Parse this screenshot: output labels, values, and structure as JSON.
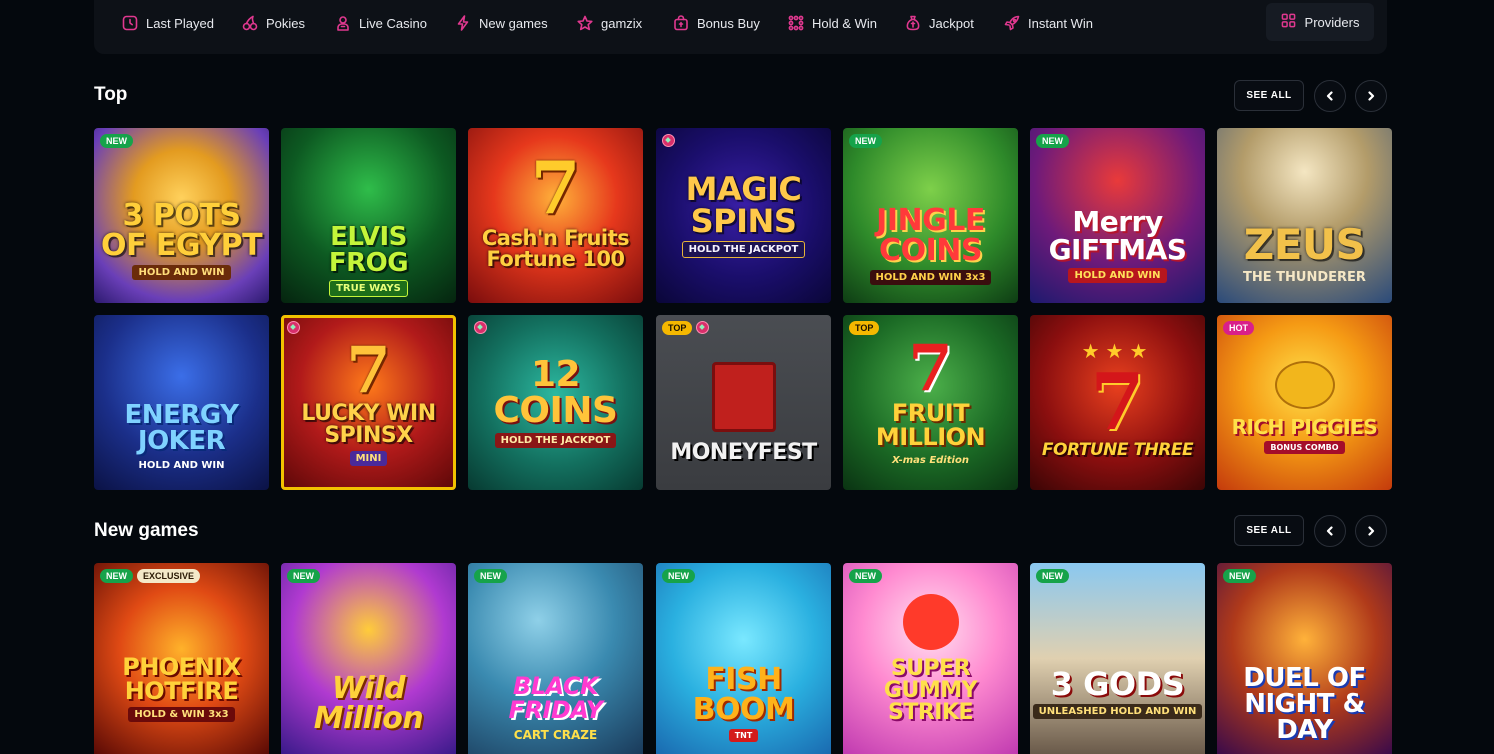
{
  "nav": {
    "items": [
      {
        "label": "Last Played",
        "icon": "clock-icon"
      },
      {
        "label": "Pokies",
        "icon": "cherries-icon"
      },
      {
        "label": "Live Casino",
        "icon": "dealer-icon"
      },
      {
        "label": "New games",
        "icon": "lightning-icon"
      },
      {
        "label": "gamzix",
        "icon": "star-icon"
      },
      {
        "label": "Bonus Buy",
        "icon": "bonus-bag-icon"
      },
      {
        "label": "Hold & Win",
        "icon": "grid-dots-icon"
      },
      {
        "label": "Jackpot",
        "icon": "money-bag-icon"
      },
      {
        "label": "Instant Win",
        "icon": "rocket-icon"
      }
    ],
    "providers_label": "Providers",
    "accent": "#e0388f"
  },
  "sections": [
    {
      "title": "Top",
      "see_all": "SEE ALL",
      "games": [
        {
          "name": "3 POTS OF EGYPT",
          "sub": "HOLD AND WIN",
          "badges": [
            "NEW"
          ],
          "gem": false
        },
        {
          "name": "ELVIS FROG",
          "sub": "TRUE WAYS",
          "badges": [],
          "gem": false
        },
        {
          "name": "Cash'n Fruits Fortune 100",
          "sub": "",
          "badges": [],
          "gem": false
        },
        {
          "name": "MAGIC SPINS",
          "sub": "HOLD THE JACKPOT",
          "badges": [],
          "gem": true
        },
        {
          "name": "JINGLE COINS",
          "sub": "HOLD AND WIN 3x3",
          "badges": [
            "NEW"
          ],
          "gem": false
        },
        {
          "name": "Merry GIFTMAS",
          "sub": "HOLD AND WIN",
          "badges": [
            "NEW"
          ],
          "gem": false
        },
        {
          "name": "ZEUS",
          "sub": "THE THUNDERER",
          "badges": [],
          "gem": false
        },
        {
          "name": "ENERGY JOKER",
          "sub": "HOLD AND WIN",
          "badges": [],
          "gem": false
        },
        {
          "name": "LUCKY WIN SPINSX",
          "sub": "MINI",
          "badges": [],
          "gem": true
        },
        {
          "name": "12 COINS",
          "sub": "HOLD THE JACKPOT",
          "badges": [],
          "gem": true
        },
        {
          "name": "MONEYFEST",
          "sub": "",
          "badges": [
            "TOP"
          ],
          "gem": true
        },
        {
          "name": "FRUIT MILLION",
          "sub": "X-mas Edition",
          "badges": [
            "TOP"
          ],
          "gem": false
        },
        {
          "name": "FORTUNE THREE",
          "sub": "",
          "badges": [],
          "gem": false
        },
        {
          "name": "RICH PIGGIES",
          "sub": "BONUS COMBO",
          "badges": [
            "HOT"
          ],
          "gem": false
        }
      ]
    },
    {
      "title": "New games",
      "see_all": "SEE ALL",
      "games": [
        {
          "name": "PHOENIX HOTFIRE",
          "sub": "HOLD & WIN 3x3",
          "badges": [
            "NEW",
            "EXCLUSIVE"
          ],
          "gem": false
        },
        {
          "name": "Wild Million",
          "sub": "",
          "badges": [
            "NEW"
          ],
          "gem": false
        },
        {
          "name": "BLACK FRIDAY",
          "sub": "CART CRAZE",
          "badges": [
            "NEW"
          ],
          "gem": false
        },
        {
          "name": "FISH BOOM",
          "sub": "TNT",
          "badges": [
            "NEW"
          ],
          "gem": false
        },
        {
          "name": "SUPER GUMMY STRIKE",
          "sub": "",
          "badges": [
            "NEW"
          ],
          "gem": false
        },
        {
          "name": "3 GODS",
          "sub": "UNLEASHED HOLD AND WIN",
          "badges": [
            "NEW"
          ],
          "gem": false
        },
        {
          "name": "DUEL OF NIGHT & DAY",
          "sub": "",
          "badges": [
            "NEW"
          ],
          "gem": false
        }
      ]
    }
  ]
}
